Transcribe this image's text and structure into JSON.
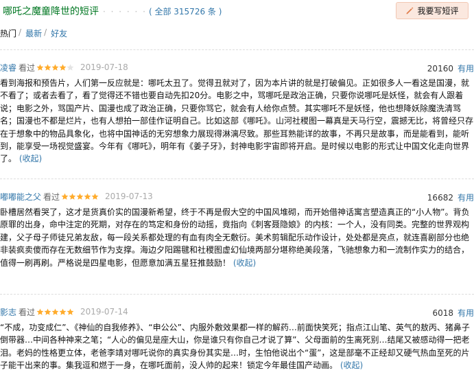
{
  "header": {
    "title": "哪吒之魔童降世的短评",
    "dots": "· · · · · ·",
    "count": "( 全部 315726 条 )",
    "write_button": "我要写短评"
  },
  "tabs": [
    {
      "label": "热门",
      "sep": "/"
    },
    {
      "label": "最新",
      "sep": "/"
    },
    {
      "label": "好友",
      "sep": ""
    }
  ],
  "colors": {
    "link": "#3377aa",
    "title": "#007722",
    "star": "#ffac2d",
    "button_bg": "#fbe8df"
  },
  "comments": [
    {
      "user": "凌睿",
      "status": "看过",
      "rating": 4,
      "date": "2019-07-18",
      "votes": "20160",
      "useful": "有用",
      "text": "看到海报和预告片，人们第一反应就是：哪吒太丑了。觉得丑就对了，因为本片讲的就是打破偏见。正如很多人一看这是国漫，就不看了；或者去看了，看了觉得还不错也要自动先扣20分。电影之中，骂哪吒是政治正确，只要你说哪吒是妖怪，就会有人跟着说；电影之外，骂国产片、国漫也成了政治正确，只要你骂它，就会有人给你点赞。其实哪吒不是妖怪，他也想降妖除魔洗清骂名；国漫也不都是烂片，也有人想拍一部佳作证明自己。比如这部《哪吒》。山河社稷图一幕真是天马行空，震撼无比，将曾经只存在于想象中的物品具象化，也将中国神话的无穷想象力展现得淋漓尽致。那些耳熟能详的故事，不再只是故事，而是能看到，能听到，能享受一场视觉盛宴。今年有《哪吒》，明年有《姜子牙》，封神电影宇宙即将开启。是时候以电影的形式让中国文化走向世界了。",
      "collapse": "(收起)"
    },
    {
      "user": "嘟嘟能之父",
      "status": "看过",
      "rating": 5,
      "date": "2019-07-13",
      "votes": "16682",
      "useful": "有用",
      "text": "卧槽居然看哭了，这才是货真价实的国漫新希望，终于不再是假大空的中国风堆砌，而开始借神话寓言塑造真正的“小人物”。背负原罪的出身，命中注定的死期，对存在的笃定和身份的动摇，竟指向《刺客聂隐娘》的内核：一个人，没有同类。完整的世界观构建，父子母子师徒兄弟友敌，每一段关系都处理的有血有肉全无敷衍。美术剪辑配乐动作设计，处处都是亮点，就连喜剧部分也绝非装疯卖傻而存在无数细节作为支撑。海边夕阳踢毽和社稷图虚幻仙境两部分堪称绝美段落，飞驰想象力和一流制作实力的结合，值得一刷再刷。严格说是四星电影，但愿意加满五星狂推鼓励！",
      "collapse": "(收起)"
    },
    {
      "user": "影志",
      "status": "看过",
      "rating": 5,
      "date": "2019-07-14",
      "votes": "6018",
      "useful": "有用",
      "text": "“不成，功变成仁”、《神仙的自我修养》、“申公公”、内服外敷效果都一样的解药…前面快笑死；指点江山笔、英气的敖丙、猪鼻子倒带器…中间各种神来之笔；“人心的偏见是座大山，你是谁只有你自己才说了算”、父母面前的生离死别…结尾又被感动得一把老泪。老妈的性格更立体，老爸李靖对哪吒说你的真实身份其实是…时，生怕他说出个“蛋”，这是部毫不正经却又硬气热血至死的片子能干出来的事。集我逗和燃于一身，在哪吒面前，没人帅的起来！锁定今年最佳国产动画。",
      "collapse": "(收起)"
    }
  ]
}
